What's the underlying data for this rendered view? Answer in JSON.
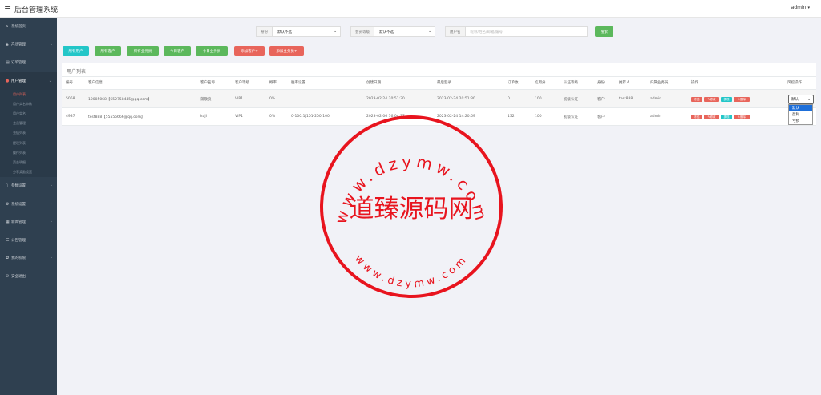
{
  "header": {
    "menu_icon": "menu-icon",
    "title": "后台管理系统",
    "user": "admin",
    "user_caret": "▾"
  },
  "sidebar": {
    "items": [
      {
        "label": "系统首页",
        "icon": "home-icon",
        "glyph": "⌂",
        "arrow": ""
      },
      {
        "label": "产品管理",
        "icon": "product-icon",
        "glyph": "◈",
        "arrow": "›"
      },
      {
        "label": "订单管理",
        "icon": "order-icon",
        "glyph": "▤",
        "arrow": "›"
      },
      {
        "label": "用户管理",
        "icon": "user-icon",
        "glyph": "●",
        "arrow": "⌄"
      }
    ],
    "user_subitems": [
      "用户列表",
      "用户实名审核",
      "用户实名",
      "会员管理",
      "充值列表",
      "提现列表",
      "操作列表",
      "资金明细",
      "分享奖励设置"
    ],
    "bottom_items": [
      {
        "label": "参数设置",
        "icon": "settings-doc-icon",
        "glyph": "▯",
        "arrow": "›"
      },
      {
        "label": "系统设置",
        "icon": "gears-icon",
        "glyph": "⚙",
        "arrow": "›"
      },
      {
        "label": "新闻管理",
        "icon": "news-icon",
        "glyph": "▦",
        "arrow": "›"
      },
      {
        "label": "公告管理",
        "icon": "notice-icon",
        "glyph": "☰",
        "arrow": "›"
      },
      {
        "label": "我的权限",
        "icon": "permission-icon",
        "glyph": "✿",
        "arrow": "›"
      },
      {
        "label": "安全退出",
        "icon": "logout-icon",
        "glyph": "⏻",
        "arrow": ""
      }
    ]
  },
  "filters": {
    "group": {
      "label": "身份",
      "value": "默认不选",
      "caret": "⌄"
    },
    "level": {
      "label": "会员等级",
      "value": "默认不选",
      "caret": "⌄"
    },
    "username": {
      "label": "用户名",
      "placeholder": "昵称/姓名/邮箱/编号"
    },
    "search_button": "搜索"
  },
  "actions": [
    "所有用户",
    "所有客户",
    "所有业务员",
    "今日客户",
    "今日业务员",
    "添加客户+",
    "添加业务员+"
  ],
  "table": {
    "title": "用户列表",
    "columns": [
      "编号",
      "客户信息",
      "客户名称",
      "客户等级",
      "概率",
      "胜率设置",
      "创建日期",
      "最后登录",
      "订单数",
      "信用分",
      "认证等级",
      "身份",
      "推荐人",
      "归属业务员",
      "操作",
      "风控操作"
    ],
    "rows": [
      {
        "id": "5068",
        "info": "10005068【652758445@qq.com】",
        "name": "蒲敬良",
        "level": "VIP1",
        "prob": "0%",
        "win": "",
        "created": "2023-02-24 20:51:30",
        "last_login": "2023-02-24 20:51:30",
        "orders": "0",
        "credit": "100",
        "auth": "初级认证",
        "role": "客户",
        "referrer": "test888",
        "agent": "admin"
      },
      {
        "id": "4987",
        "info": "test888【55556666@qq.com】",
        "name": "kuji",
        "level": "VIP1",
        "prob": "0%",
        "win": "0-100:1|101-200:100",
        "created": "2023-02-06 16:04:27",
        "last_login": "2023-02-24 14:20:59",
        "orders": "132",
        "credit": "100",
        "auth": "初级认证",
        "role": "客户",
        "referrer": "",
        "agent": "admin"
      }
    ],
    "op_buttons": [
      "冻结",
      "✎修改",
      "提现",
      "✎删除"
    ]
  },
  "risk": {
    "selected": "默认",
    "caret": "⌄",
    "options": [
      "默认",
      "盈利",
      "亏损"
    ]
  },
  "colors": {
    "sidebar_bg": "#2f4050",
    "accent_red": "#e8655b",
    "cyan": "#23c6c8",
    "green": "#5cb85c",
    "seal_red": "#e8141e"
  },
  "watermark": {
    "top_arc": "www.dzymw.com",
    "center": "道臻源码网",
    "bottom_arc": "www.dzymw.com"
  }
}
